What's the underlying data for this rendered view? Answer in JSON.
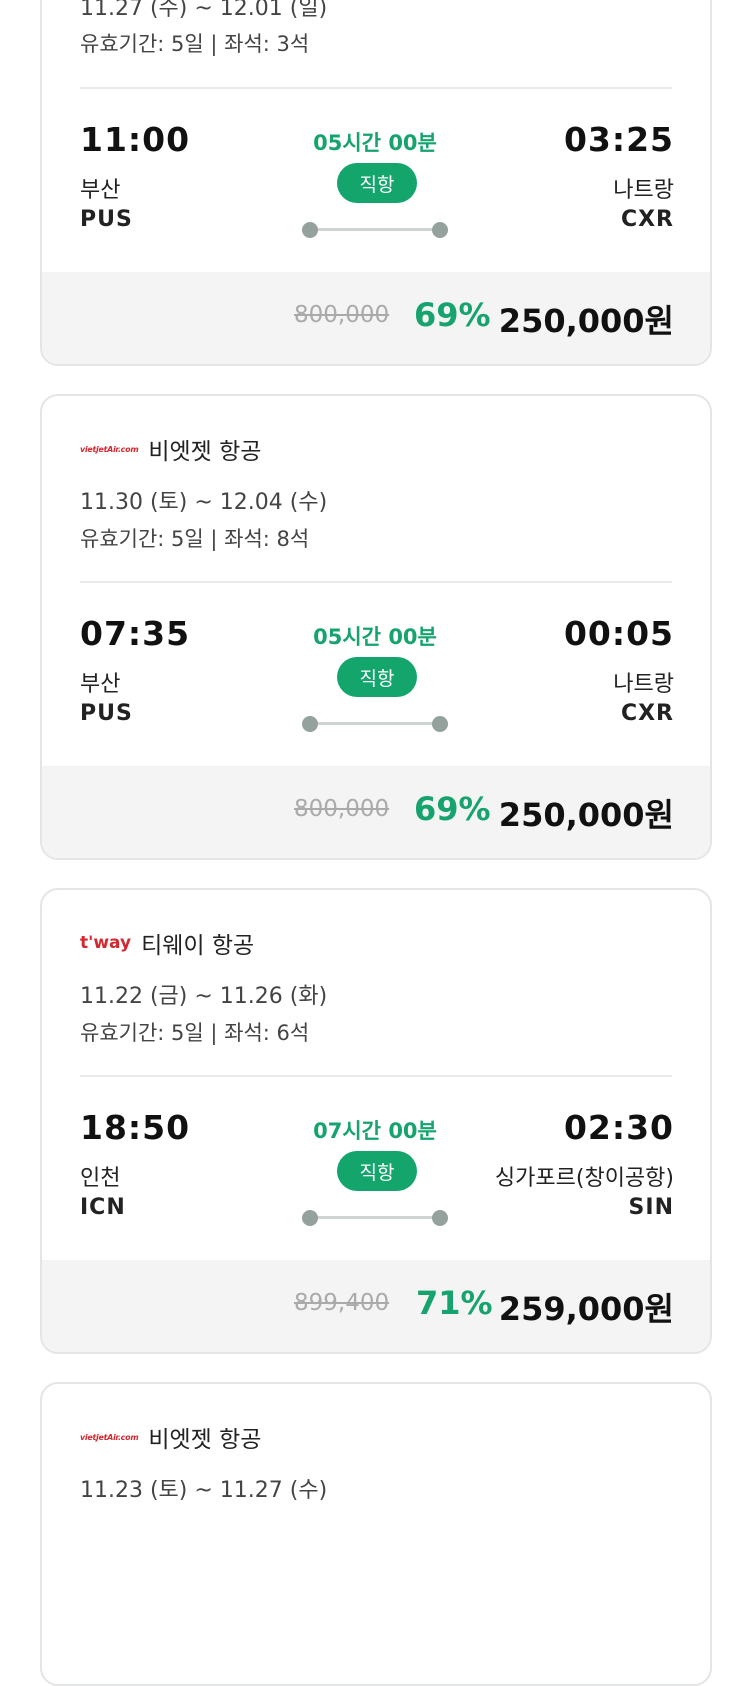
{
  "flights": [
    {
      "dates": "11.27 (수) ~ 12.01 (일)",
      "validity": "유효기간: 5일 | 좌석: 3석",
      "depart_time": "11:00",
      "depart_city": "부산",
      "depart_code": "PUS",
      "arrive_time": "03:25",
      "arrive_city": "나트랑",
      "arrive_code": "CXR",
      "duration": "05시간 00분",
      "type": "직항",
      "original_price": "800,000",
      "discount": "69%",
      "price": "250,000원"
    },
    {
      "airline_logo": "vietjetAir.com",
      "airline": "비엣젯 항공",
      "dates": "11.30 (토) ~ 12.04 (수)",
      "validity": "유효기간: 5일 | 좌석: 8석",
      "depart_time": "07:35",
      "depart_city": "부산",
      "depart_code": "PUS",
      "arrive_time": "00:05",
      "arrive_city": "나트랑",
      "arrive_code": "CXR",
      "duration": "05시간 00분",
      "type": "직항",
      "original_price": "800,000",
      "discount": "69%",
      "price": "250,000원"
    },
    {
      "airline_logo": "t'way",
      "airline": "티웨이 항공",
      "dates": "11.22 (금) ~ 11.26 (화)",
      "validity": "유효기간: 5일 | 좌석: 6석",
      "depart_time": "18:50",
      "depart_city": "인천",
      "depart_code": "ICN",
      "arrive_time": "02:30",
      "arrive_city": "싱가포르(창이공항)",
      "arrive_code": "SIN",
      "duration": "07시간 00분",
      "type": "직항",
      "original_price": "899,400",
      "discount": "71%",
      "price": "259,000원"
    },
    {
      "airline_logo": "vietjetAir.com",
      "airline": "비엣젯 항공",
      "dates": "11.23 (토) ~ 11.27 (수)"
    }
  ]
}
